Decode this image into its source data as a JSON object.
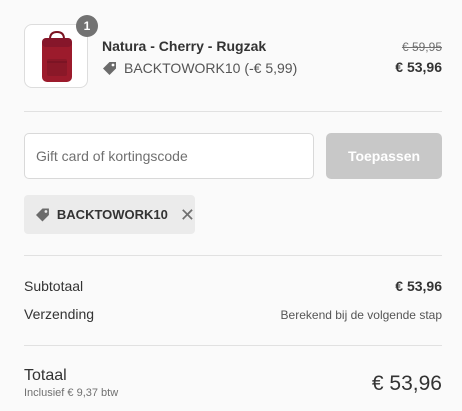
{
  "product": {
    "quantity": "1",
    "name": "Natura - Cherry - Rugzak",
    "discount_text": "BACKTOWORK10 (-€ 5,99)",
    "original_price": "€ 59,95",
    "price": "€ 53,96",
    "image_icon": "red-backpack-image"
  },
  "discount_form": {
    "placeholder": "Gift card of kortingscode",
    "value": "",
    "apply_label": "Toepassen"
  },
  "applied_code": {
    "label": "BACKTOWORK10",
    "remove_icon": "close-icon"
  },
  "summary": {
    "subtotal_label": "Subtotaal",
    "subtotal_value": "€ 53,96",
    "shipping_label": "Verzending",
    "shipping_value": "Berekend bij de volgende stap"
  },
  "total": {
    "label": "Totaal",
    "tax_note": "Inclusief € 9,37 btw",
    "value": "€ 53,96"
  },
  "colors": {
    "background": "#fafafa",
    "button_disabled": "#c8c8c8",
    "backpack": "#9c1b2c",
    "tag_background": "#ebebeb"
  }
}
